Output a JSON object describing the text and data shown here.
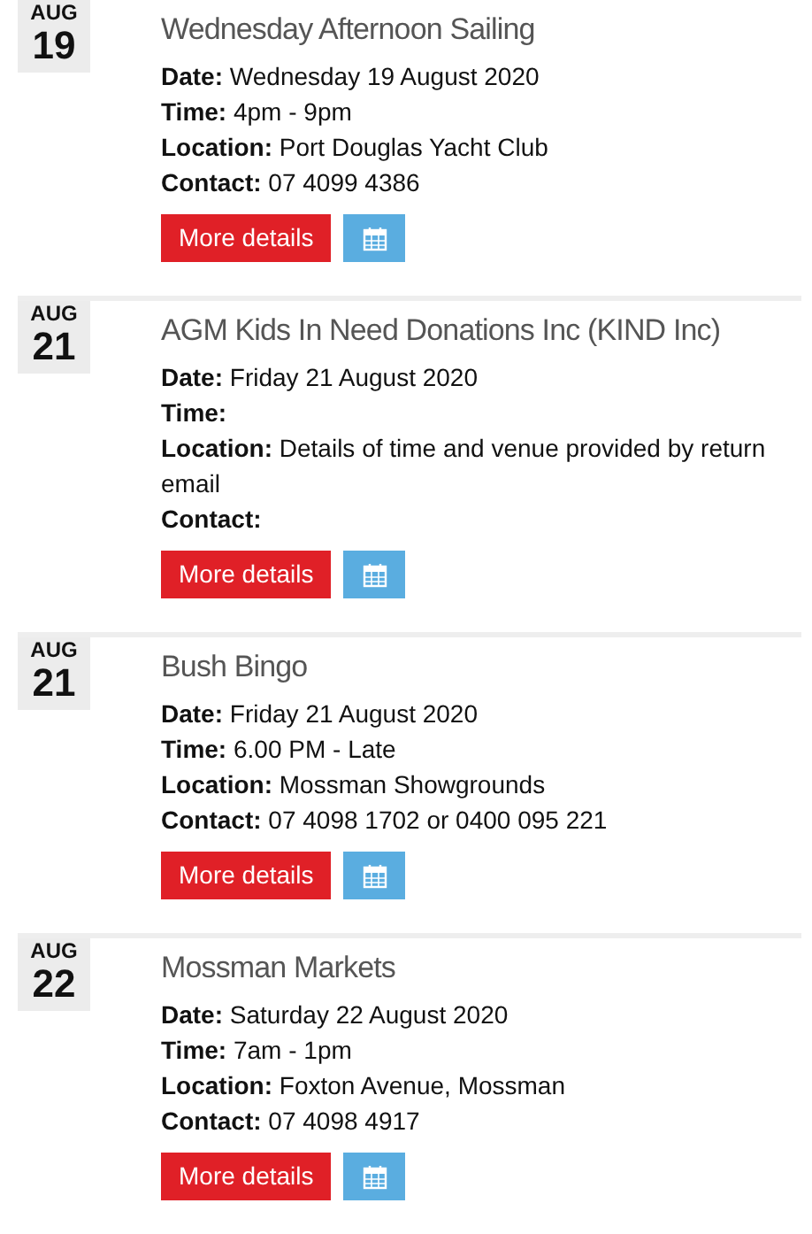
{
  "events": [
    {
      "month": "AUG",
      "day": "19",
      "title": "Wednesday Afternoon Sailing",
      "fields": [
        {
          "label": "Date:",
          "value": "Wednesday 19 August 2020"
        },
        {
          "label": "Time:",
          "value": "4pm - 9pm"
        },
        {
          "label": "Location:",
          "value": "Port Douglas Yacht Club"
        },
        {
          "label": "Contact:",
          "value": "07 4099 4386"
        }
      ],
      "button": "More details"
    },
    {
      "month": "AUG",
      "day": "21",
      "title": "AGM Kids In Need Donations Inc (KIND Inc)",
      "fields": [
        {
          "label": "Date:",
          "value": "Friday 21 August 2020"
        },
        {
          "label": "Time:"
        },
        {
          "label": "Location:",
          "value": "Details of time and venue provided by return email"
        },
        {
          "label": "Contact:"
        }
      ],
      "button": "More details"
    },
    {
      "month": "AUG",
      "day": "21",
      "title": "Bush Bingo",
      "fields": [
        {
          "label": "Date:",
          "value": "Friday 21 August 2020"
        },
        {
          "label": "Time:",
          "value": "6.00 PM - Late"
        },
        {
          "label": "Location:",
          "value": "Mossman Showgrounds"
        },
        {
          "label": "Contact:",
          "value": "07 4098 1702 or 0400 095 221"
        }
      ],
      "button": "More details"
    },
    {
      "month": "AUG",
      "day": "22",
      "title": "Mossman Markets",
      "fields": [
        {
          "label": "Date:",
          "value": "Saturday 22 August 2020"
        },
        {
          "label": "Time:",
          "value": "7am - 1pm"
        },
        {
          "label": "Location:",
          "value": "Foxton Avenue, Mossman"
        },
        {
          "label": "Contact:",
          "value": "07 4098 4917"
        }
      ],
      "button": "More details"
    }
  ]
}
